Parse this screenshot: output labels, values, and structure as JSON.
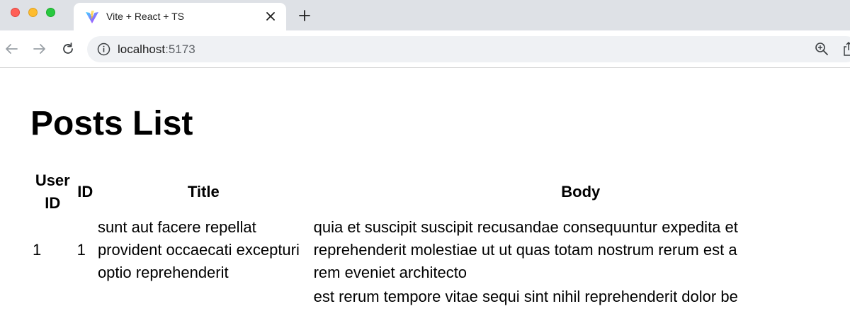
{
  "browser": {
    "tab": {
      "title": "Vite + React + TS",
      "favicon": "vite-logo-icon"
    },
    "address_bar": {
      "host": "localhost",
      "port": ":5173"
    },
    "colors": {
      "tabstrip": "#dee1e6",
      "omnibox": "#eff1f4",
      "close_red": "#ff5f57",
      "minimize_yellow": "#febc2e",
      "zoom_green": "#28c840"
    }
  },
  "page": {
    "title": "Posts List",
    "table": {
      "headers": {
        "user_id": "User ID",
        "id": "ID",
        "title": "Title",
        "body": "Body"
      },
      "rows": [
        {
          "user_id": "1",
          "id": "1",
          "title": "sunt aut facere repellat provident occaecati excepturi optio reprehenderit",
          "body_lines": [
            "quia et suscipit suscipit recusandae consequuntur expedita et",
            "reprehenderit molestiae ut ut quas totam nostrum rerum est a",
            "rem eveniet architecto"
          ]
        },
        {
          "body_lines": [
            "est rerum tempore vitae sequi sint nihil reprehenderit dolor be"
          ]
        }
      ]
    }
  }
}
